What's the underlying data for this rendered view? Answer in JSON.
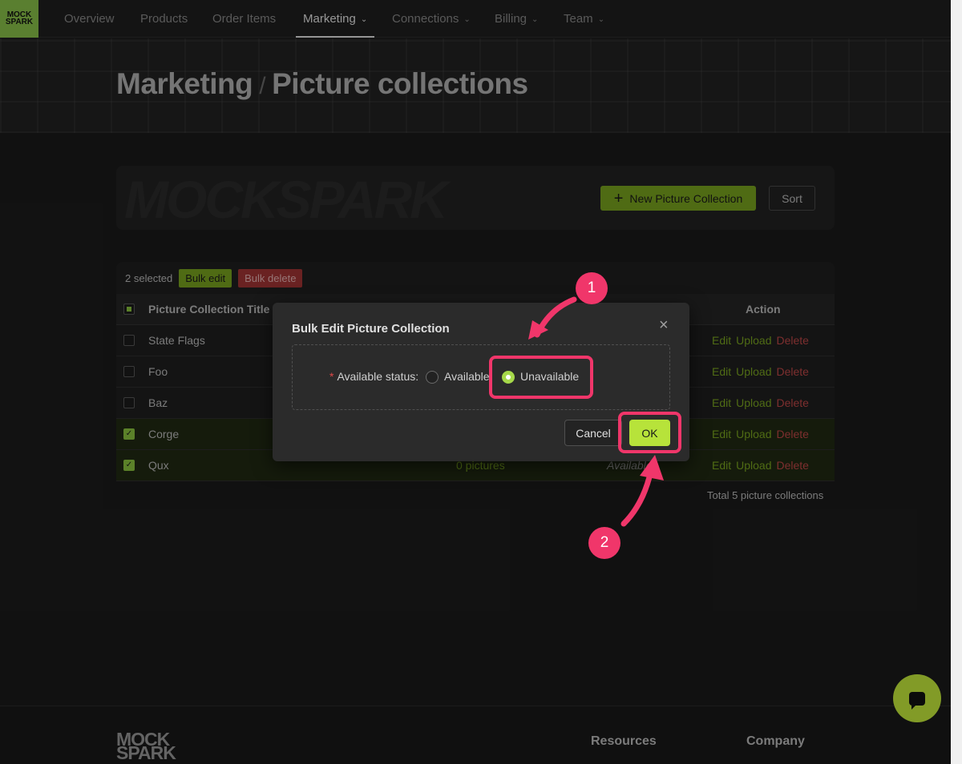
{
  "nav": {
    "logo_line1": "MOCK",
    "logo_line2": "SPARK",
    "items": [
      {
        "label": "Overview"
      },
      {
        "label": "Products"
      },
      {
        "label": "Order Items"
      },
      {
        "label": "Marketing"
      },
      {
        "label": "Connections"
      },
      {
        "label": "Billing"
      },
      {
        "label": "Team"
      }
    ],
    "active": "Marketing"
  },
  "hero": {
    "breadcrumb_parent": "Marketing",
    "separator": "/",
    "title": "Picture collections"
  },
  "toolbar": {
    "watermark": "MOCKSPARK",
    "new_label": "New Picture Collection",
    "sort_label": "Sort"
  },
  "bulk": {
    "selected_text": "2 selected",
    "edit_label": "Bulk edit",
    "delete_label": "Bulk delete"
  },
  "table": {
    "col_title": "Picture Collection Title",
    "col_action": "Action",
    "rows": [
      {
        "title": "State Flags",
        "checked": false
      },
      {
        "title": "Foo",
        "checked": false
      },
      {
        "title": "Baz",
        "checked": false
      },
      {
        "title": "Corge",
        "checked": true
      },
      {
        "title": "Qux",
        "checked": true,
        "pictures": "0 pictures",
        "status": "Available"
      }
    ],
    "actions": {
      "edit": "Edit",
      "upload": "Upload",
      "delete": "Delete"
    },
    "total": "Total 5 picture collections"
  },
  "modal": {
    "title": "Bulk Edit Picture Collection",
    "close": "×",
    "required_mark": "*",
    "field_label": "Available status:",
    "options": [
      "Available",
      "Unavailable"
    ],
    "selected": "Unavailable",
    "cancel_label": "Cancel",
    "ok_label": "OK"
  },
  "annotations": {
    "step1": "1",
    "step2": "2",
    "color": "#f0366a"
  },
  "footer": {
    "logo_line1": "MOCK",
    "logo_line2": "SPARK",
    "resources": "Resources",
    "company": "Company"
  },
  "colors": {
    "accent": "#7aa51f",
    "ok": "#b7e33a",
    "danger": "#c04848"
  }
}
